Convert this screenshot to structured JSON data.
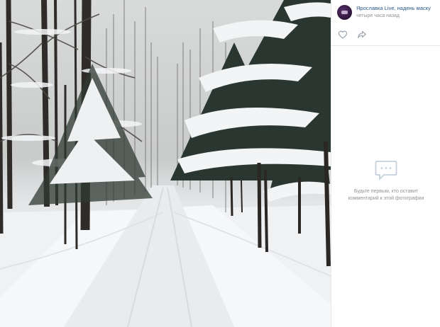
{
  "post": {
    "author": "Ярославка Live, надень маску",
    "time": "четыре часа назад",
    "avatar_icon": "group-avatar",
    "like_icon": "heart-outline-icon",
    "share_icon": "share-arrow-icon"
  },
  "comments": {
    "empty_icon": "comment-bubble-icon",
    "empty_text": "Будьте первым, кто оставит комментарий к этой фотографии"
  },
  "photo": {
    "subject": "snowy-forest-path"
  },
  "colors": {
    "link": "#2a5885",
    "muted": "#939393",
    "icon": "#99a2ad",
    "divider": "#e7e8ec"
  }
}
